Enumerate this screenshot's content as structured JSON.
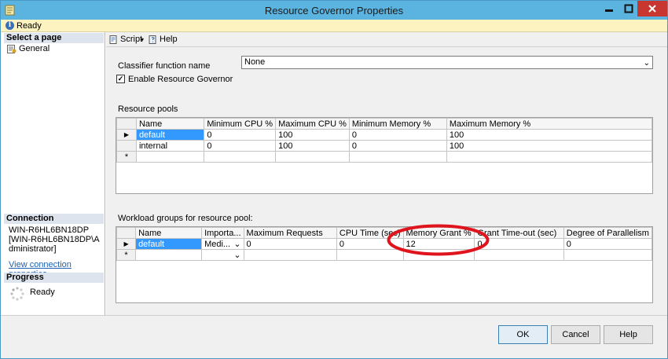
{
  "window": {
    "title": "Resource Governor Properties"
  },
  "status": {
    "text": "Ready"
  },
  "left_pane": {
    "select_page_header": "Select a page",
    "pages": [
      {
        "label": "General",
        "icon": "page-settings-icon"
      }
    ],
    "connection_header": "Connection",
    "connection_text": [
      "WIN-R6HL6BN18DP",
      "[WIN-R6HL6BN18DP\\A",
      "dministrator]"
    ],
    "view_connection_link": "View connection properties",
    "progress_header": "Progress",
    "progress_status": "Ready"
  },
  "toolbar": {
    "script_label": "Script",
    "help_label": "Help"
  },
  "general": {
    "classifier_label": "Classifier function name",
    "classifier_value": "None",
    "enable_label": "Enable Resource Governor",
    "enable_checked": true,
    "resource_pools_label": "Resource pools",
    "workload_groups_label": "Workload groups for resource pool:"
  },
  "resource_pools": {
    "columns": [
      "Name",
      "Minimum CPU %",
      "Maximum CPU %",
      "Minimum Memory %",
      "Maximum Memory %"
    ],
    "rows": [
      [
        "default",
        "0",
        "100",
        "0",
        "100"
      ],
      [
        "internal",
        "0",
        "100",
        "0",
        "100"
      ]
    ],
    "new_row_marker": "*",
    "current_row_marker": "▶"
  },
  "workload_groups": {
    "columns": [
      "Name",
      "Importa...",
      "Maximum Requests",
      "CPU Time (sec)",
      "Memory Grant %",
      "Grant Time-out (sec)",
      "Degree of Parallelism"
    ],
    "rows": [
      [
        "default",
        "Medi...",
        "0",
        "0",
        "12",
        "0",
        "0"
      ]
    ],
    "new_row_marker": "*",
    "current_row_marker": "▶"
  },
  "buttons": {
    "ok": "OK",
    "cancel": "Cancel",
    "help": "Help"
  },
  "colors": {
    "titlebar": "#5bb3e0",
    "selection": "#3399ff",
    "annotation": "#e0141c",
    "status_bar": "#fdf3c0"
  }
}
